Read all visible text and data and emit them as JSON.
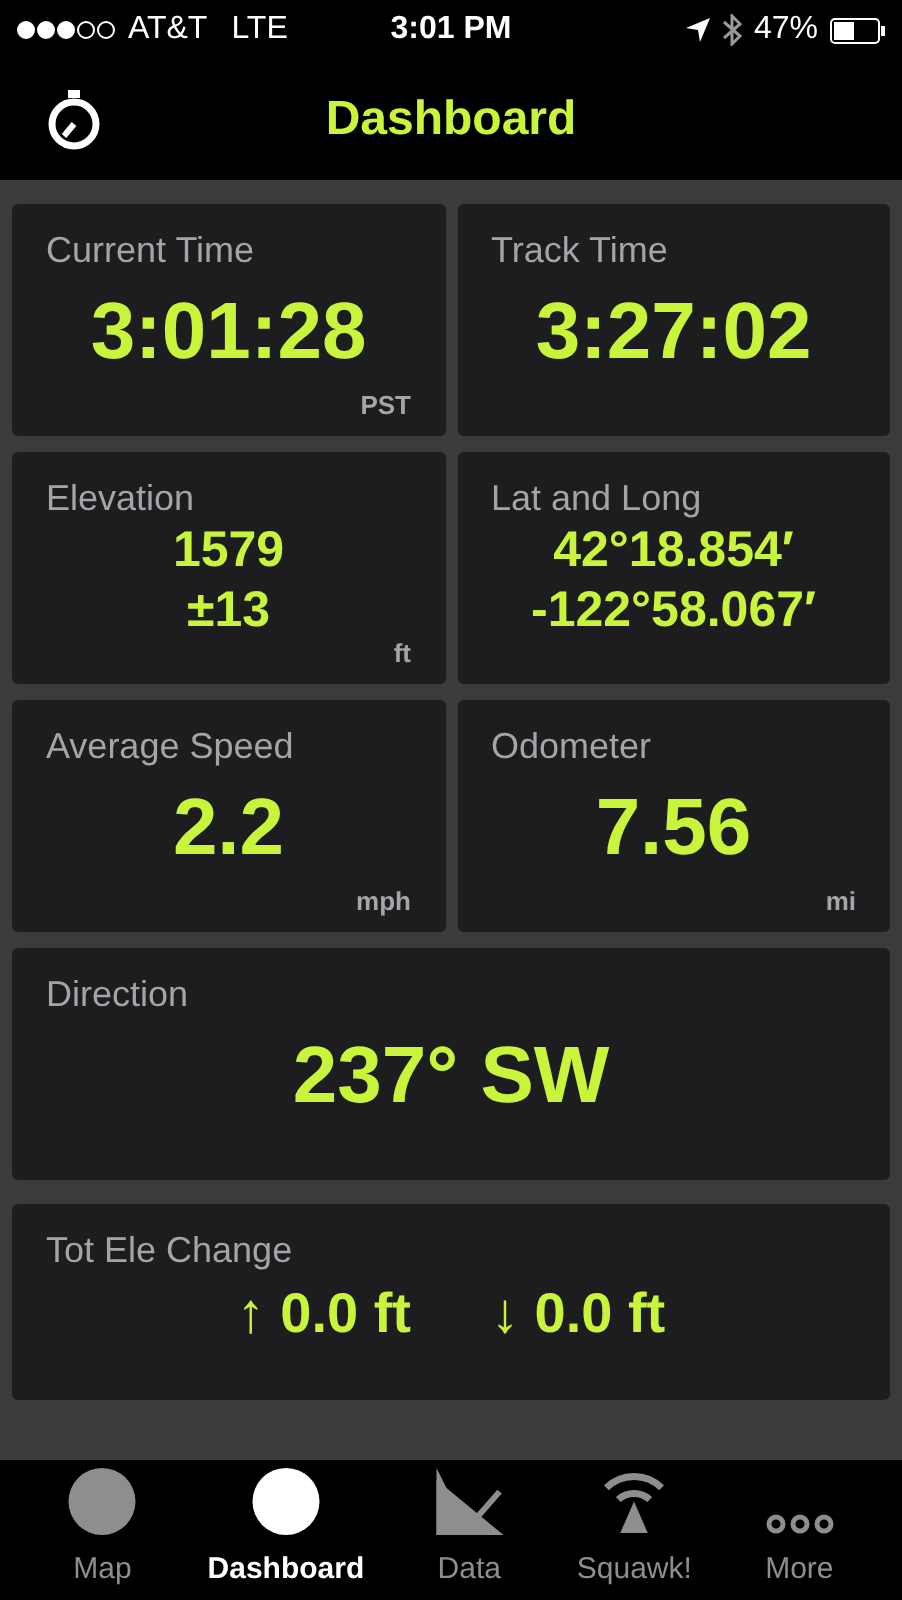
{
  "status_bar": {
    "carrier": "AT&T",
    "network": "LTE",
    "time": "3:01 PM",
    "battery": "47%"
  },
  "header": {
    "title": "Dashboard"
  },
  "tiles": [
    {
      "kind": "half",
      "label": "Current Time",
      "values": [
        "3:01:28"
      ],
      "unit": "PST"
    },
    {
      "kind": "half",
      "label": "Track Time",
      "values": [
        "3:27:02"
      ]
    },
    {
      "kind": "half_small",
      "label": "Elevation",
      "values": [
        "1579",
        "±13"
      ],
      "unit": "ft"
    },
    {
      "kind": "half_small",
      "label": "Lat and Long",
      "values": [
        "42°18.854′",
        "-122°58.067′"
      ]
    },
    {
      "kind": "half",
      "label": "Average Speed",
      "values": [
        "2.2"
      ],
      "unit": "mph"
    },
    {
      "kind": "half",
      "label": "Odometer",
      "values": [
        "7.56"
      ],
      "unit": "mi"
    },
    {
      "kind": "full",
      "label": "Direction",
      "values": [
        "237° SW"
      ]
    },
    {
      "kind": "full_pair",
      "label": "Tot Ele Change",
      "values": [
        "↑ 0.0 ft",
        "↓ 0.0 ft"
      ]
    }
  ],
  "tab_bar": [
    {
      "kind": "circle",
      "label": "Map",
      "selected": false
    },
    {
      "kind": "circle",
      "label": "Dashboard",
      "selected": true
    },
    {
      "kind": "chart",
      "label": "Data",
      "selected": false
    },
    {
      "kind": "antenna",
      "label": "Squawk!",
      "selected": false
    },
    {
      "kind": "dots",
      "label": "More",
      "selected": false
    }
  ]
}
